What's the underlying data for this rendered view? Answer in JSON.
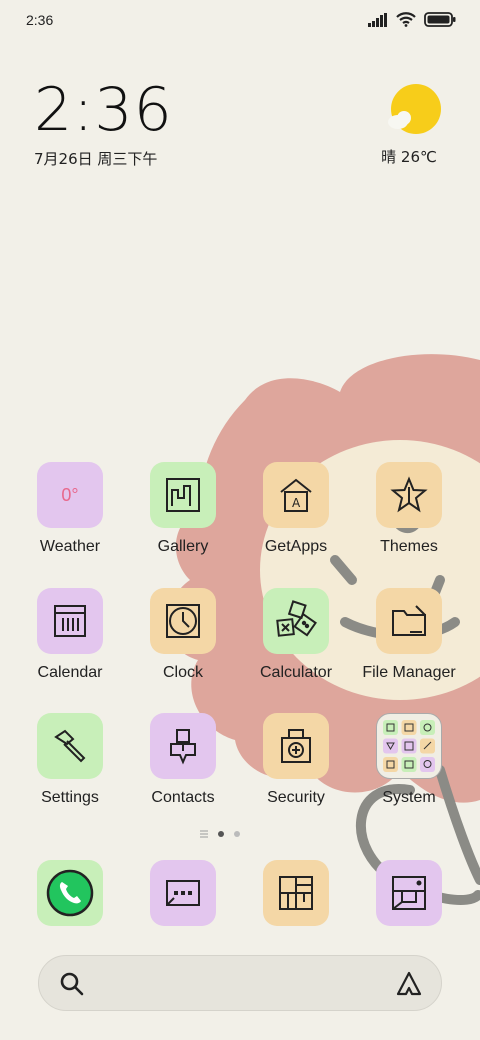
{
  "status_bar": {
    "time": "2:36"
  },
  "clock_widget": {
    "time": "2:36",
    "date": "7月26日 周三下午"
  },
  "weather_widget": {
    "text": "晴 26℃",
    "icon": "sun-cloud-icon"
  },
  "apps": [
    {
      "label": "Weather",
      "icon": "weather-icon",
      "icon_text": "0°"
    },
    {
      "label": "Gallery",
      "icon": "gallery-icon"
    },
    {
      "label": "GetApps",
      "icon": "getapps-icon",
      "icon_text": "A"
    },
    {
      "label": "Themes",
      "icon": "star-icon"
    },
    {
      "label": "Calendar",
      "icon": "calendar-icon"
    },
    {
      "label": "Clock",
      "icon": "clock-icon"
    },
    {
      "label": "Calculator",
      "icon": "calculator-icon"
    },
    {
      "label": "File Manager",
      "icon": "folder-icon"
    },
    {
      "label": "Settings",
      "icon": "hammer-icon"
    },
    {
      "label": "Contacts",
      "icon": "contacts-icon"
    },
    {
      "label": "Security",
      "icon": "security-icon"
    },
    {
      "label": "System",
      "icon": "folder-grid-icon"
    }
  ],
  "page_indicator": {
    "pages": 2,
    "current": 1
  },
  "dock": [
    {
      "name": "phone",
      "icon": "phone-icon"
    },
    {
      "name": "messages",
      "icon": "messages-icon"
    },
    {
      "name": "browser",
      "icon": "browser-icon"
    },
    {
      "name": "camera",
      "icon": "camera-icon"
    }
  ],
  "search": {
    "icon": "search-icon",
    "assistant_icon": "assistant-icon"
  },
  "colors": {
    "background": "#f2f0e8",
    "tile_purple": "#e3c6ee",
    "tile_green": "#c8efb9",
    "tile_orange": "#f4d7a6",
    "flower_petal": "#dea69c",
    "flower_center": "#f4ebd6",
    "stem": "#8b8b86"
  }
}
